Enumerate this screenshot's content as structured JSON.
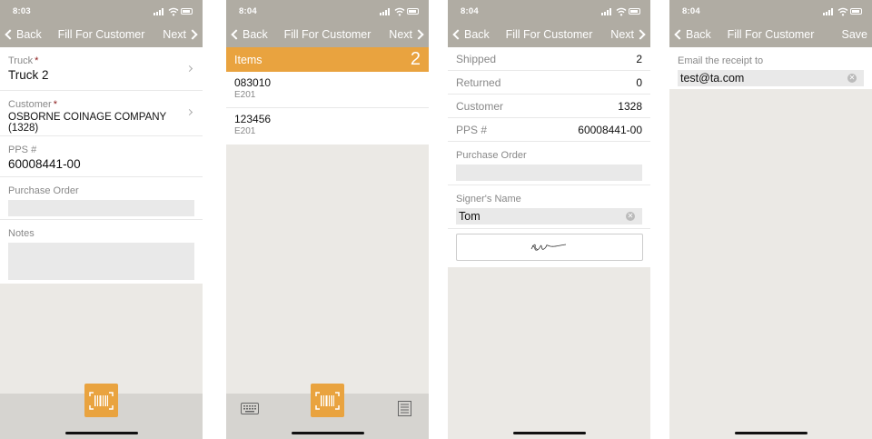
{
  "screens": [
    {
      "status": {
        "time": "8:03"
      },
      "nav": {
        "back": "Back",
        "title": "Fill For Customer",
        "right": "Next"
      },
      "fields": {
        "truck": {
          "label": "Truck",
          "value": "Truck 2"
        },
        "customer": {
          "label": "Customer",
          "value": "OSBORNE COINAGE COMPANY (1328)"
        },
        "pps": {
          "label": "PPS #",
          "value": "60008441-00"
        },
        "purchase_order": {
          "label": "Purchase Order",
          "value": ""
        },
        "notes": {
          "label": "Notes",
          "value": ""
        }
      },
      "required_mark": "*"
    },
    {
      "status": {
        "time": "8:04"
      },
      "nav": {
        "back": "Back",
        "title": "Fill For Customer",
        "right": "Next"
      },
      "items_header": {
        "label": "Items",
        "count": "2"
      },
      "items": [
        {
          "code": "083010",
          "sub": "E201"
        },
        {
          "code": "123456",
          "sub": "E201"
        }
      ]
    },
    {
      "status": {
        "time": "8:04"
      },
      "nav": {
        "back": "Back",
        "title": "Fill For Customer",
        "right": "Next"
      },
      "rows": [
        {
          "label": "Shipped",
          "value": "2"
        },
        {
          "label": "Returned",
          "value": "0"
        },
        {
          "label": "Customer",
          "value": "1328"
        },
        {
          "label": "PPS #",
          "value": "60008441-00"
        }
      ],
      "purchase_order": {
        "label": "Purchase Order",
        "value": ""
      },
      "signer": {
        "label": "Signer's Name",
        "value": "Tom"
      }
    },
    {
      "status": {
        "time": "8:04"
      },
      "nav": {
        "back": "Back",
        "title": "Fill For Customer",
        "right": "Save"
      },
      "email": {
        "label": "Email the receipt to",
        "value": "test@ta.com"
      }
    }
  ],
  "colors": {
    "accent": "#e9a33f",
    "navbar": "#b0aca3",
    "background": "#ebe9e5"
  },
  "icons": [
    "location-arrow-icon",
    "signal-icon",
    "wifi-icon",
    "battery-icon",
    "chevron-left-icon",
    "chevron-right-icon",
    "barcode-scan-icon",
    "keyboard-icon",
    "list-icon",
    "clear-icon"
  ]
}
